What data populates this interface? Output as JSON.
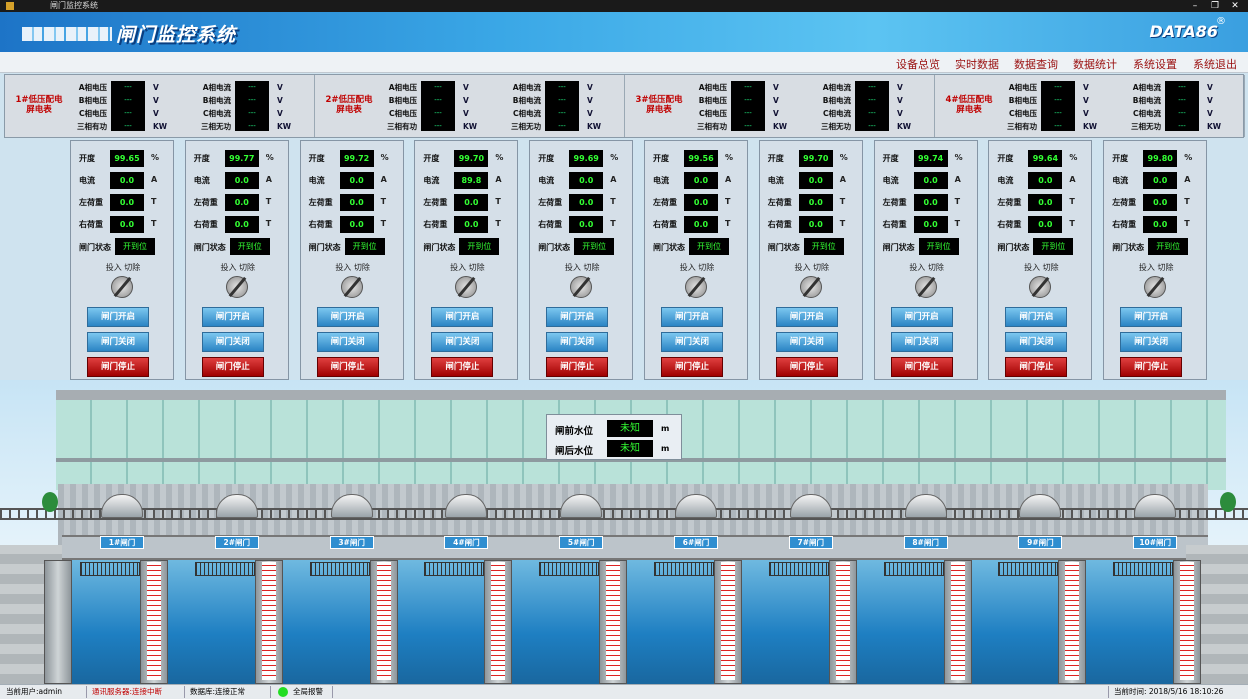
{
  "window": {
    "title": "闸门监控系统",
    "min": "–",
    "max": "❐",
    "close": "✕"
  },
  "banner": {
    "title": "闸门监控系统",
    "logo": "DATA86",
    "reg": "®"
  },
  "menu": [
    "设备总览",
    "实时数据",
    "数据查询",
    "数据统计",
    "系统设置",
    "系统退出"
  ],
  "meters": [
    {
      "name": "1#低压配电屏电表",
      "c1": [
        "A相电压",
        "B相电压",
        "C相电压",
        "三相有功"
      ],
      "u1": [
        "V",
        "V",
        "V",
        "KW"
      ],
      "c2": [
        "A相电流",
        "B相电流",
        "C相电流",
        "三相无功"
      ],
      "u2": [
        "V",
        "V",
        "V",
        "KW"
      ]
    },
    {
      "name": "2#低压配电屏电表",
      "c1": [
        "A相电压",
        "B相电压",
        "C相电压",
        "三相有功"
      ],
      "u1": [
        "V",
        "V",
        "V",
        "KW"
      ],
      "c2": [
        "A相电流",
        "B相电流",
        "C相电流",
        "三相无功"
      ],
      "u2": [
        "V",
        "V",
        "V",
        "KW"
      ]
    },
    {
      "name": "3#低压配电屏电表",
      "c1": [
        "A相电压",
        "B相电压",
        "C相电压",
        "三相有功"
      ],
      "u1": [
        "V",
        "V",
        "V",
        "KW"
      ],
      "c2": [
        "A相电流",
        "B相电流",
        "C相电流",
        "三相无功"
      ],
      "u2": [
        "V",
        "V",
        "V",
        "KW"
      ]
    },
    {
      "name": "4#低压配电屏电表",
      "c1": [
        "A相电压",
        "B相电压",
        "C相电压",
        "三相有功"
      ],
      "u1": [
        "V",
        "V",
        "V",
        "KW"
      ],
      "c2": [
        "A相电流",
        "B相电流",
        "C相电流",
        "三相无功"
      ],
      "u2": [
        "V",
        "V",
        "V",
        "KW"
      ]
    }
  ],
  "meter_dash": "---",
  "labels": {
    "open": "开度",
    "cur": "电流",
    "lload": "左荷重",
    "rload": "右荷重",
    "state": "闸门状态",
    "switch": "投入  切除",
    "btn_open": "闸门开启",
    "btn_close": "闸门关闭",
    "btn_stop": "闸门停止",
    "u_pct": "%",
    "u_a": "A",
    "u_t": "T"
  },
  "gates": [
    {
      "open": "99.65",
      "cur": "0.0",
      "lload": "0.0",
      "rload": "0.0",
      "state": "开到位",
      "label": "1#闸门"
    },
    {
      "open": "99.77",
      "cur": "0.0",
      "lload": "0.0",
      "rload": "0.0",
      "state": "开到位",
      "label": "2#闸门"
    },
    {
      "open": "99.72",
      "cur": "0.0",
      "lload": "0.0",
      "rload": "0.0",
      "state": "开到位",
      "label": "3#闸门"
    },
    {
      "open": "99.70",
      "cur": "89.8",
      "lload": "0.0",
      "rload": "0.0",
      "state": "开到位",
      "label": "4#闸门"
    },
    {
      "open": "99.69",
      "cur": "0.0",
      "lload": "0.0",
      "rload": "0.0",
      "state": "开到位",
      "label": "5#闸门"
    },
    {
      "open": "99.56",
      "cur": "0.0",
      "lload": "0.0",
      "rload": "0.0",
      "state": "开到位",
      "label": "6#闸门"
    },
    {
      "open": "99.70",
      "cur": "0.0",
      "lload": "0.0",
      "rload": "0.0",
      "state": "开到位",
      "label": "7#闸门"
    },
    {
      "open": "99.74",
      "cur": "0.0",
      "lload": "0.0",
      "rload": "0.0",
      "state": "开到位",
      "label": "8#闸门"
    },
    {
      "open": "99.64",
      "cur": "0.0",
      "lload": "0.0",
      "rload": "0.0",
      "state": "开到位",
      "label": "9#闸门"
    },
    {
      "open": "99.80",
      "cur": "0.0",
      "lload": "0.0",
      "rload": "0.0",
      "state": "开到位",
      "label": "10#闸门"
    }
  ],
  "waterlevel": {
    "front_label": "闸前水位",
    "front_value": "未知",
    "back_label": "闸后水位",
    "back_value": "未知",
    "unit": "m"
  },
  "status": {
    "user": "当前用户:admin",
    "server": "通讯服务器:连接中断",
    "db": "数据库:连接正常",
    "alarm": "全局报警",
    "time": "当前时间: 2018/5/16 18:10:26"
  }
}
